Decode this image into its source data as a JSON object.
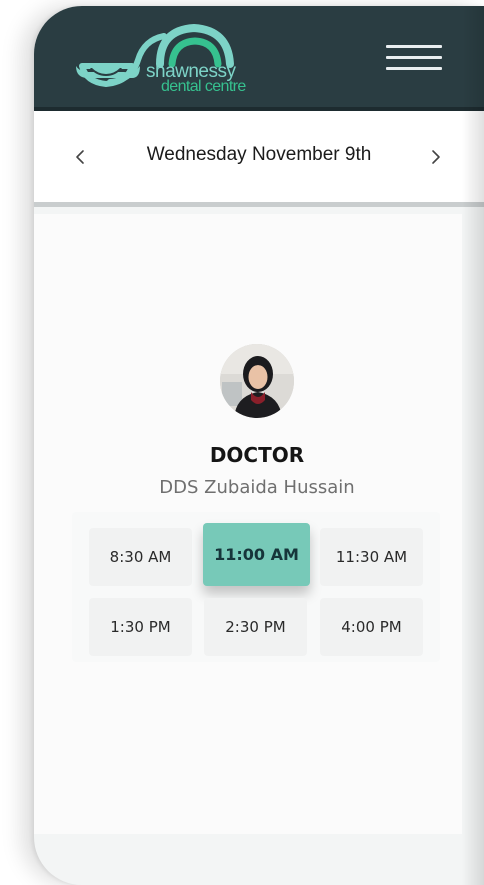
{
  "brand": {
    "name_line_1": "shawnessy",
    "name_line_2": "dental centre",
    "colors": {
      "header_bg": "#2a3d42",
      "logo_teal": "#7dd3c7",
      "logo_green": "#36c18f",
      "selected_slot": "#77c9b8"
    }
  },
  "header": {
    "menu_icon": "hamburger-menu-icon"
  },
  "date_nav": {
    "prev_icon": "chevron-left-icon",
    "label": "Wednesday November 9th",
    "next_icon": "chevron-right-icon"
  },
  "doctor": {
    "avatar_icon": "doctor-avatar",
    "role": "DOCTOR",
    "name": "DDS Zubaida Hussain"
  },
  "time_slots": [
    {
      "label": "8:30 AM",
      "selected": false
    },
    {
      "label": "11:00 AM",
      "selected": true
    },
    {
      "label": "11:30 AM",
      "selected": false
    },
    {
      "label": "1:30 PM",
      "selected": false
    },
    {
      "label": "2:30 PM",
      "selected": false
    },
    {
      "label": "4:00 PM",
      "selected": false
    }
  ]
}
